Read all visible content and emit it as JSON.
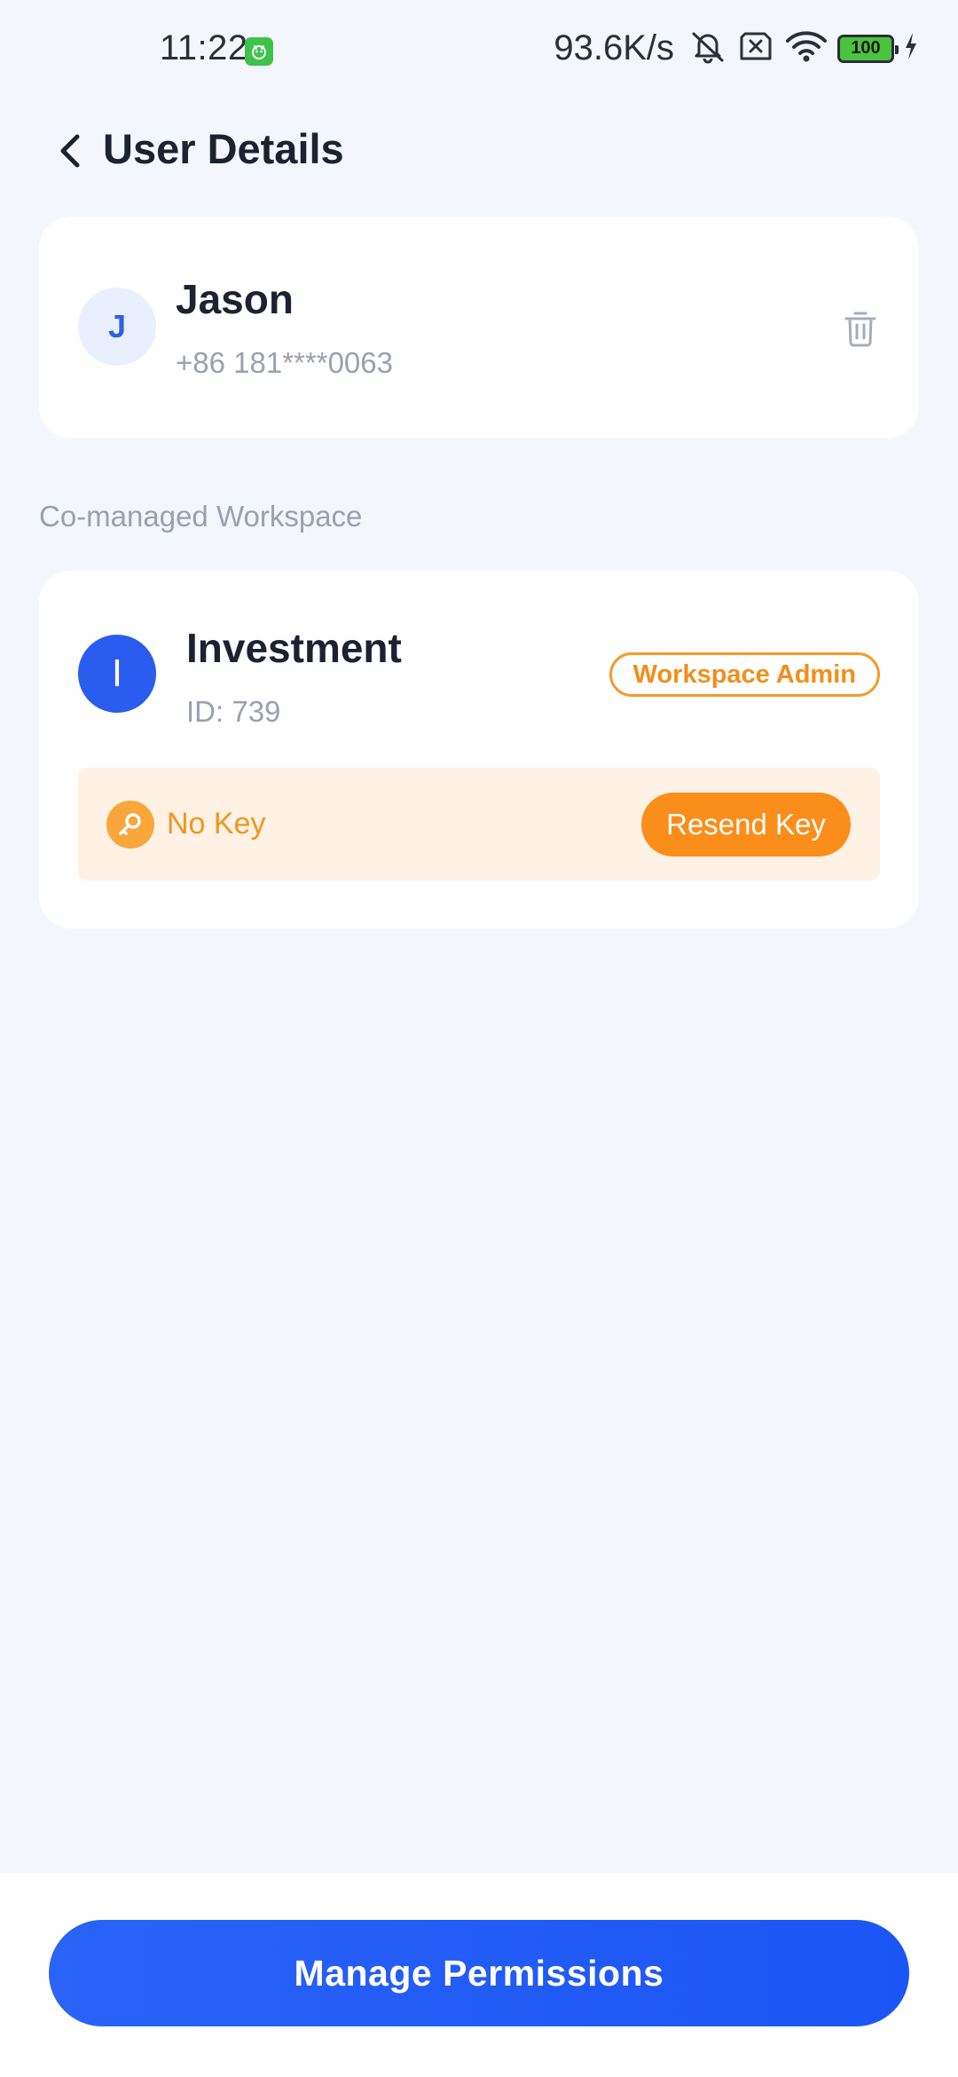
{
  "status_bar": {
    "time": "11:22",
    "net_speed": "93.6K/s",
    "battery": "100",
    "icons": [
      "app-notification-icon",
      "mute-bell-icon",
      "sim-blocked-icon",
      "wifi-icon",
      "battery-icon",
      "charging-bolt-icon"
    ]
  },
  "header": {
    "title": "User Details"
  },
  "user": {
    "initial": "J",
    "name": "Jason",
    "phone": "+86 181****0063"
  },
  "section": {
    "label": "Co-managed Workspace"
  },
  "workspace": {
    "initial": "I",
    "name": "Investment",
    "id_text": "ID: 739",
    "role": "Workspace Admin",
    "key_status": "No Key",
    "resend_label": "Resend Key"
  },
  "footer": {
    "primary_label": "Manage Permissions"
  },
  "colors": {
    "background": "#f3f6fd",
    "primary": "#1b55f5",
    "accent_orange": "#fb8d1a",
    "muted_text": "#9aa0ad"
  }
}
